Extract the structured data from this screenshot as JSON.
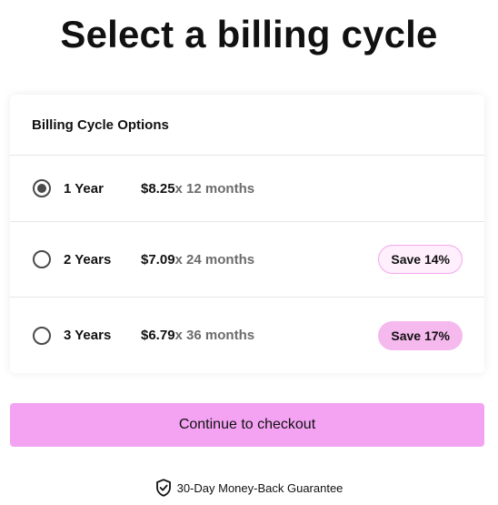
{
  "page": {
    "title": "Select a billing cycle"
  },
  "card": {
    "header": "Billing Cycle Options",
    "options": [
      {
        "label": "1 Year",
        "price": "$8.25",
        "months": "x 12 months",
        "selected": true,
        "badge": ""
      },
      {
        "label": "2 Years",
        "price": "$7.09",
        "months": "x 24 months",
        "selected": false,
        "badge": "Save 14%"
      },
      {
        "label": "3 Years",
        "price": "$6.79",
        "months": "x 36 months",
        "selected": false,
        "badge": "Save 17%"
      }
    ]
  },
  "checkout": {
    "button_label": "Continue to checkout"
  },
  "guarantee": {
    "icon": "shield-check-icon",
    "text": "30-Day Money-Back Guarantee"
  },
  "colors": {
    "accent": "#f4a3f3",
    "badge_outline_bg": "#ffeefc",
    "badge_filled_bg": "#f6b9ee",
    "muted_text": "#6b6b6b"
  }
}
